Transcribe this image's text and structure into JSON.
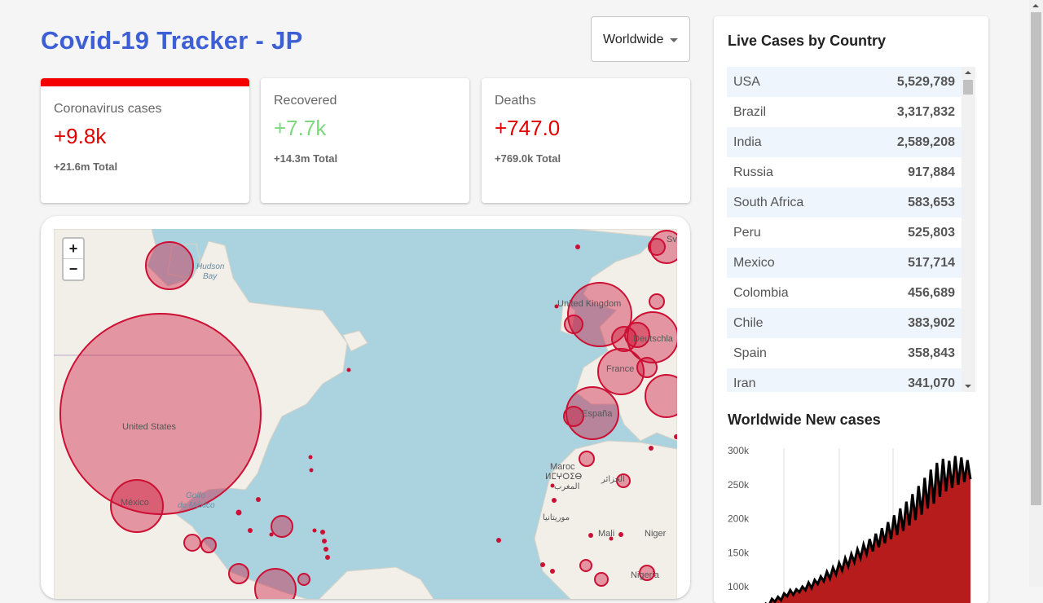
{
  "header": {
    "title": "Covid-19 Tracker - JP"
  },
  "country_select": {
    "selected": "Worldwide"
  },
  "cards": [
    {
      "label": "Coronavirus cases",
      "value": "+9.8k",
      "total": "+21.6m Total"
    },
    {
      "label": "Recovered",
      "value": "+7.7k",
      "total": "+14.3m Total"
    },
    {
      "label": "Deaths",
      "value": "+747.0",
      "total": "+769.0k Total"
    }
  ],
  "colors": {
    "accent": "#3d5fd6",
    "cases": "#e10000",
    "recovered": "#7dd87d",
    "circle": "#cc1034",
    "chart_fill": "#b71c1c"
  },
  "map": {
    "zoom_in": "+",
    "zoom_out": "−",
    "labels": {
      "hudson": "Hudson",
      "hudson2": "Bay",
      "us": "United States",
      "mexico": "México",
      "golfo": "Golfo",
      "golfo2": "de México",
      "uk": "United Kingdom",
      "deutsch": "Deutschla",
      "france": "France",
      "espana": "España",
      "maroc": "Maroc",
      "maroc2": "ⵍⵎⵖⵔⵉⴱ",
      "maroc3": "المغرب",
      "alg": "الجزائر",
      "maur": "موريتانيا",
      "mali": "Mali",
      "niger": "Niger",
      "nigeria": "Nigeria",
      "sv": "Sv"
    }
  },
  "live_cases": {
    "title": "Live Cases by Country",
    "rows": [
      {
        "country": "USA",
        "cases": "5,529,789"
      },
      {
        "country": "Brazil",
        "cases": "3,317,832"
      },
      {
        "country": "India",
        "cases": "2,589,208"
      },
      {
        "country": "Russia",
        "cases": "917,884"
      },
      {
        "country": "South Africa",
        "cases": "583,653"
      },
      {
        "country": "Peru",
        "cases": "525,803"
      },
      {
        "country": "Mexico",
        "cases": "517,714"
      },
      {
        "country": "Colombia",
        "cases": "456,689"
      },
      {
        "country": "Chile",
        "cases": "383,902"
      },
      {
        "country": "Spain",
        "cases": "358,843"
      },
      {
        "country": "Iran",
        "cases": "341,070"
      }
    ]
  },
  "new_cases_title": "Worldwide New cases",
  "chart_data": {
    "type": "area",
    "title": "Worldwide New cases",
    "yticks": [
      "300k",
      "250k",
      "200k",
      "150k",
      "100k"
    ],
    "ylim": [
      80000,
      300000
    ],
    "values": [
      68000,
      75000,
      72000,
      82000,
      78000,
      85000,
      80000,
      90000,
      86000,
      95000,
      88000,
      96000,
      92000,
      100000,
      95000,
      106000,
      98000,
      110000,
      104000,
      115000,
      108000,
      122000,
      112000,
      128000,
      118000,
      135000,
      124000,
      142000,
      130000,
      148000,
      136000,
      155000,
      142000,
      162000,
      148000,
      170000,
      152000,
      178000,
      158000,
      186000,
      164000,
      195000,
      170000,
      205000,
      176000,
      215000,
      182000,
      225000,
      190000,
      236000,
      198000,
      248000,
      206000,
      260000,
      215000,
      272000,
      222000,
      282000,
      232000,
      288000,
      240000,
      285000,
      245000,
      292000,
      250000,
      290000,
      254000,
      286000,
      258000
    ]
  }
}
